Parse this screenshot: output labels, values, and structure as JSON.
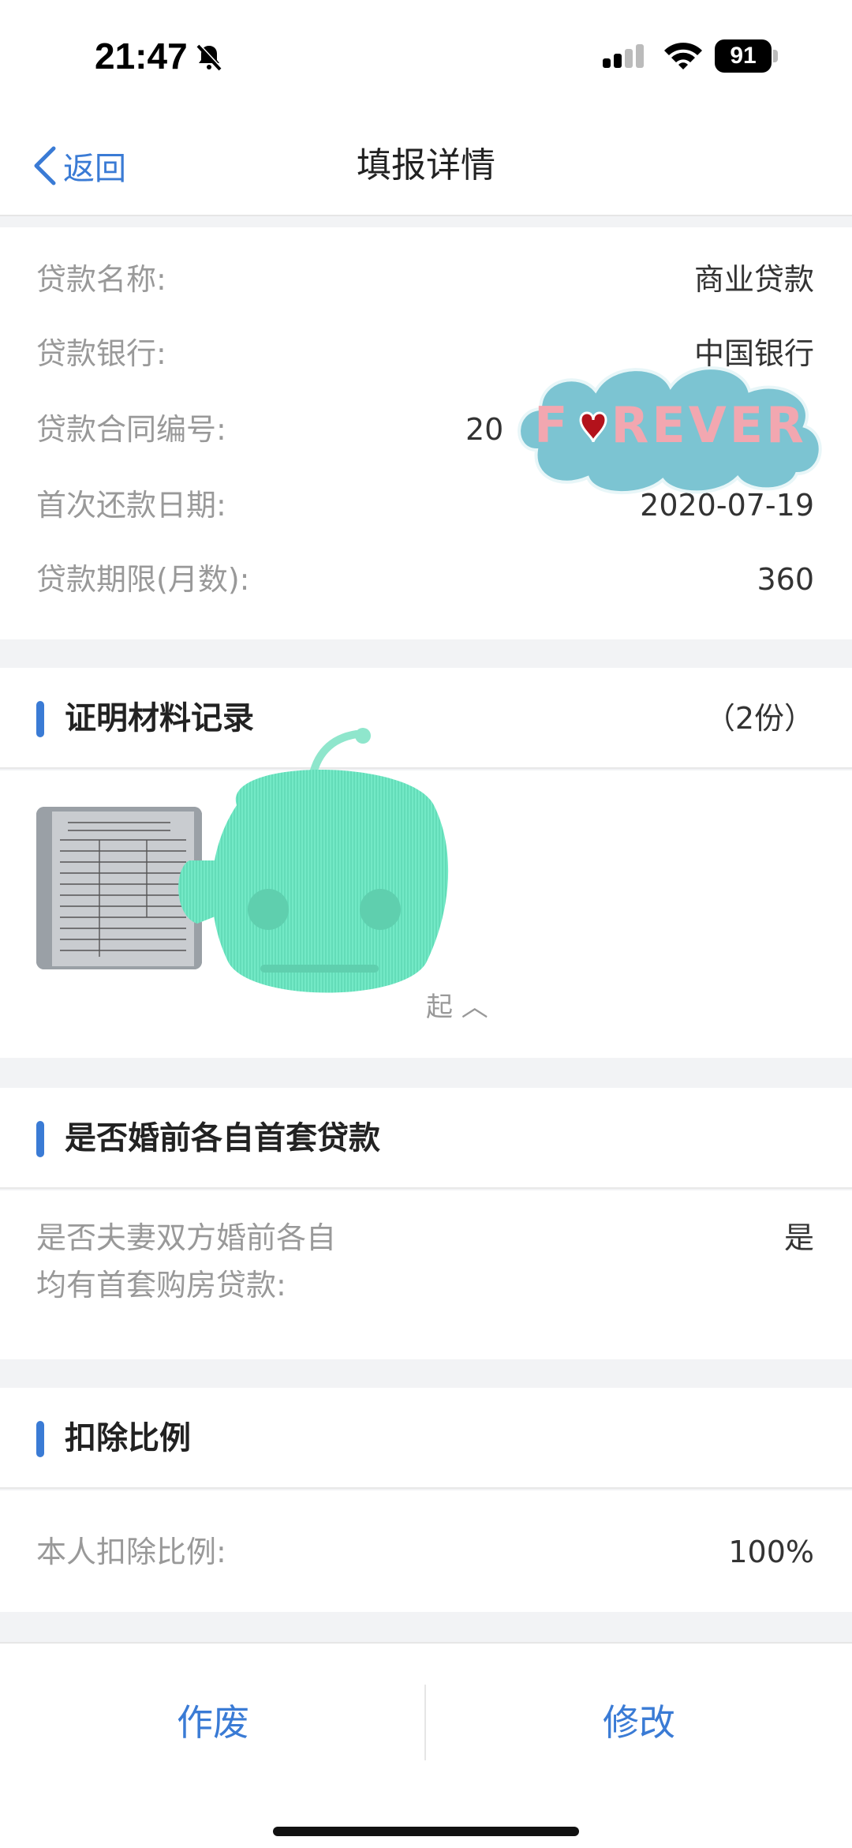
{
  "status_bar": {
    "time": "21:47",
    "battery": "91"
  },
  "nav": {
    "back_label": "返回",
    "title": "填报详情"
  },
  "loan_info": [
    {
      "label": "贷款名称:",
      "value": "商业贷款"
    },
    {
      "label": "贷款银行:",
      "value": "中国银行"
    },
    {
      "label": "贷款合同编号:",
      "value": "20"
    },
    {
      "label": "首次还款日期:",
      "value": "2020-07-19"
    },
    {
      "label": "贷款期限(月数):",
      "value": "360"
    }
  ],
  "proof_section": {
    "title": "证明材料记录",
    "count": "（2份）",
    "collapse_label": "起 ︿"
  },
  "marriage_section": {
    "title": "是否婚前各自首套贷款",
    "question_line1": "是否夫妻双方婚前各自",
    "question_line2": "均有首套购房贷款:",
    "answer": "是"
  },
  "deduction_section": {
    "title": "扣除比例",
    "label": "本人扣除比例:",
    "value": "100%"
  },
  "bottom_bar": {
    "void_label": "作废",
    "edit_label": "修改"
  },
  "stickers": {
    "cloud_text": "FOREVER"
  },
  "colors": {
    "accent": "#3a7bd5",
    "background": "#f2f3f5"
  }
}
